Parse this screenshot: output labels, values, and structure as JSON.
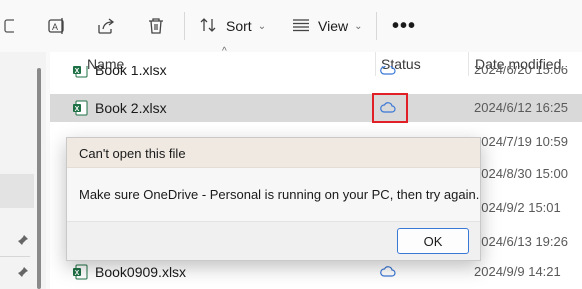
{
  "toolbar": {
    "sort_label": "Sort",
    "view_label": "View",
    "more_label": "•••",
    "chevron": "⌄"
  },
  "columns": {
    "name": "Name",
    "status": "Status",
    "date_modified": "Date modified"
  },
  "files": [
    {
      "name": "Book 1.xlsx",
      "date": "2024/6/20 15:06",
      "status": "cloud-icon"
    },
    {
      "name": "Book 2.xlsx",
      "date": "2024/6/12 16:25",
      "status": "cloud-icon",
      "selected": true
    },
    {
      "name": "",
      "date": "2024/7/19 10:59"
    },
    {
      "name": "",
      "date": "2024/8/30 15:00"
    },
    {
      "name": "",
      "date": "2024/9/2 15:01"
    },
    {
      "name": "",
      "date": "2024/6/13 19:26"
    },
    {
      "name": "Book0909.xlsx",
      "date": "2024/9/9 14:21",
      "status": "cloud-icon"
    }
  ],
  "dialog": {
    "title": "Can't open this file",
    "message": "Make sure OneDrive - Personal is running on your PC, then try again.",
    "ok_label": "OK"
  },
  "colors": {
    "highlight": "#e01f26",
    "button_border": "#3a78d6",
    "excel_green": "#1d7044"
  }
}
